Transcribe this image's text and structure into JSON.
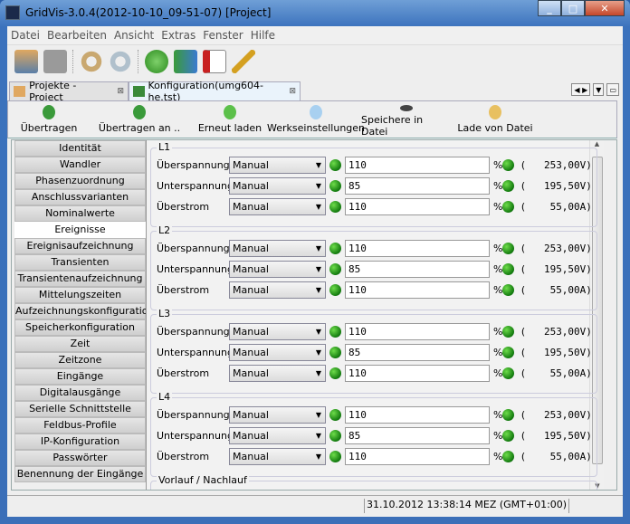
{
  "window": {
    "title": "GridVis-3.0.4(2012-10-10_09-51-07) [Project]",
    "minimize": "_",
    "maximize": "□",
    "close": "✕"
  },
  "menu": [
    "Datei",
    "Bearbeiten",
    "Ansicht",
    "Extras",
    "Fenster",
    "Hilfe"
  ],
  "toolbar_icons": [
    "open-project-icon",
    "save-icon",
    "undo-icon",
    "redo-icon",
    "transfer-icon",
    "database-transfer-icon",
    "import-icon",
    "keys-icon"
  ],
  "tabs": [
    {
      "label": "Projekte - Project",
      "close": "⊠"
    },
    {
      "label": "Konfiguration(umg604-he.tst)",
      "close": "⊠"
    }
  ],
  "actions": [
    {
      "label": "Übertragen",
      "icon": "transfer-icon"
    },
    {
      "label": "Übertragen an ..",
      "icon": "transfer-to-icon"
    },
    {
      "label": "Erneut laden",
      "icon": "reload-icon"
    },
    {
      "label": "Werkseinstellungen",
      "icon": "factory-settings-icon"
    },
    {
      "label": "Speichere in Datei",
      "icon": "save-file-icon"
    },
    {
      "label": "Lade von Datei",
      "icon": "load-file-icon"
    }
  ],
  "sidebar": {
    "selected": "Ereignisse",
    "items": [
      "Identität",
      "Wandler",
      "Phasenzuordnung",
      "Anschlussvarianten",
      "Nominalwerte",
      "Ereignisse",
      "Ereignisaufzeichnung",
      "Transienten",
      "Transientenaufzeichnung",
      "Mittelungszeiten",
      "Aufzeichnungskonfiguration",
      "Speicherkonfiguration",
      "Zeit",
      "Zeitzone",
      "Eingänge",
      "Digitalausgänge",
      "Serielle Schnittstelle",
      "Feldbus-Profile",
      "IP-Konfiguration",
      "Passwörter",
      "Benennung der Eingänge"
    ]
  },
  "groups": [
    {
      "label": "L1",
      "rows": [
        {
          "name": "Überspannung",
          "mode": "Manual",
          "value": "110",
          "unit": "%",
          "calc": "(   253,00V)"
        },
        {
          "name": "Unterspannung",
          "mode": "Manual",
          "value": "85",
          "unit": "%",
          "calc": "(   195,50V)"
        },
        {
          "name": "Überstrom",
          "mode": "Manual",
          "value": "110",
          "unit": "%",
          "calc": "(    55,00A)"
        }
      ]
    },
    {
      "label": "L2",
      "rows": [
        {
          "name": "Überspannung",
          "mode": "Manual",
          "value": "110",
          "unit": "%",
          "calc": "(   253,00V)"
        },
        {
          "name": "Unterspannung",
          "mode": "Manual",
          "value": "85",
          "unit": "%",
          "calc": "(   195,50V)"
        },
        {
          "name": "Überstrom",
          "mode": "Manual",
          "value": "110",
          "unit": "%",
          "calc": "(    55,00A)"
        }
      ]
    },
    {
      "label": "L3",
      "rows": [
        {
          "name": "Überspannung",
          "mode": "Manual",
          "value": "110",
          "unit": "%",
          "calc": "(   253,00V)"
        },
        {
          "name": "Unterspannung",
          "mode": "Manual",
          "value": "85",
          "unit": "%",
          "calc": "(   195,50V)"
        },
        {
          "name": "Überstrom",
          "mode": "Manual",
          "value": "110",
          "unit": "%",
          "calc": "(    55,00A)"
        }
      ]
    },
    {
      "label": "L4",
      "rows": [
        {
          "name": "Überspannung",
          "mode": "Manual",
          "value": "110",
          "unit": "%",
          "calc": "(   253,00V)"
        },
        {
          "name": "Unterspannung",
          "mode": "Manual",
          "value": "85",
          "unit": "%",
          "calc": "(   195,50V)"
        },
        {
          "name": "Überstrom",
          "mode": "Manual",
          "value": "110",
          "unit": "%",
          "calc": "(    55,00A)"
        }
      ]
    }
  ],
  "next_group": "Vorlauf / Nachlauf",
  "status": {
    "datetime": "31.10.2012 13:38:14 MEZ (GMT+01:00)"
  },
  "colors": {
    "led_ok": "#1a9a12",
    "titlebar": "#3b72bd"
  }
}
